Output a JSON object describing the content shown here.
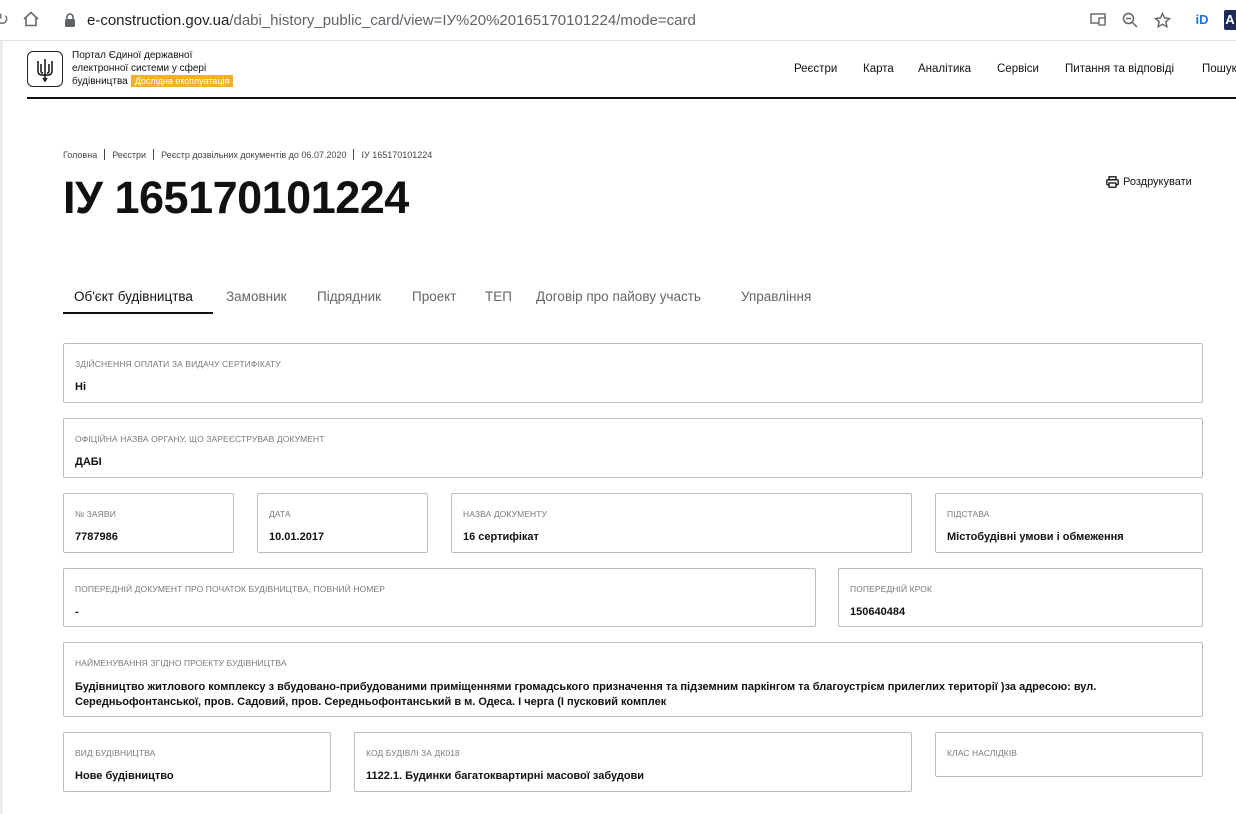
{
  "browser": {
    "url_domain": "e-construction.gov.ua",
    "url_path": "/dabi_history_public_card/view=ІУ%20%20165170101224/mode=card"
  },
  "header": {
    "portal_line1": "Портал Єдиної державної",
    "portal_line2": "електронної системи у сфері",
    "portal_line3": "будівництва",
    "badge": "Дослідна експлуатація",
    "nav": [
      "Реєстри",
      "Карта",
      "Аналітика",
      "Сервіси",
      "Питання та відповіді",
      "Пошук"
    ]
  },
  "breadcrumb": [
    "Головна",
    "Реєстри",
    "Реєстр дозвільних документів до 06.07.2020",
    "ІУ 165170101224"
  ],
  "page": {
    "title": "ІУ 165170101224",
    "print_label": "Роздрукувати"
  },
  "tabs": [
    "Об'єкт будівництва",
    "Замовник",
    "Підрядник",
    "Проект",
    "ТЕП",
    "Договір про пайову участь",
    "Управління"
  ],
  "fields": {
    "payment": {
      "label": "Здійснення оплати за видачу сертифікату",
      "value": "Ні"
    },
    "authority": {
      "label": "Офіційна назва органу, що зареєстрував документ",
      "value": "ДАБІ"
    },
    "app_no": {
      "label": "№ заяви",
      "value": "7787986"
    },
    "date": {
      "label": "Дата",
      "value": "10.01.2017"
    },
    "doc_name": {
      "label": "Назва документу",
      "value": "16 сертифікат"
    },
    "basis": {
      "label": "Підстава",
      "value": "Містобудівні умови і обмеження"
    },
    "prev_doc": {
      "label": "Попередній документ про початок будівництва, повний номер",
      "value": "-"
    },
    "prev_step": {
      "label": "Попередній крок",
      "value": "150640484"
    },
    "project_name": {
      "label": "Найменування згідно проекту будівництва",
      "value": "Будівництво житлового комплексу з вбудовано-прибудованими приміщеннями громадського призначення та підземним паркінгом та благоустрієм прилеглих території )за адресою: вул. Середньофонтанської, пров. Садовий, пров. Середньофонтанський в м. Одеса. І черга (І пусковий комплек"
    },
    "construction_type": {
      "label": "Вид будівництва",
      "value": "Нове будівництво"
    },
    "building_code": {
      "label": "Код будівлі за ДК018",
      "value": "1122.1. Будинки багатоквартирні масової забудови"
    },
    "consequence_class": {
      "label": "Клас наслідків",
      "value": ""
    }
  }
}
